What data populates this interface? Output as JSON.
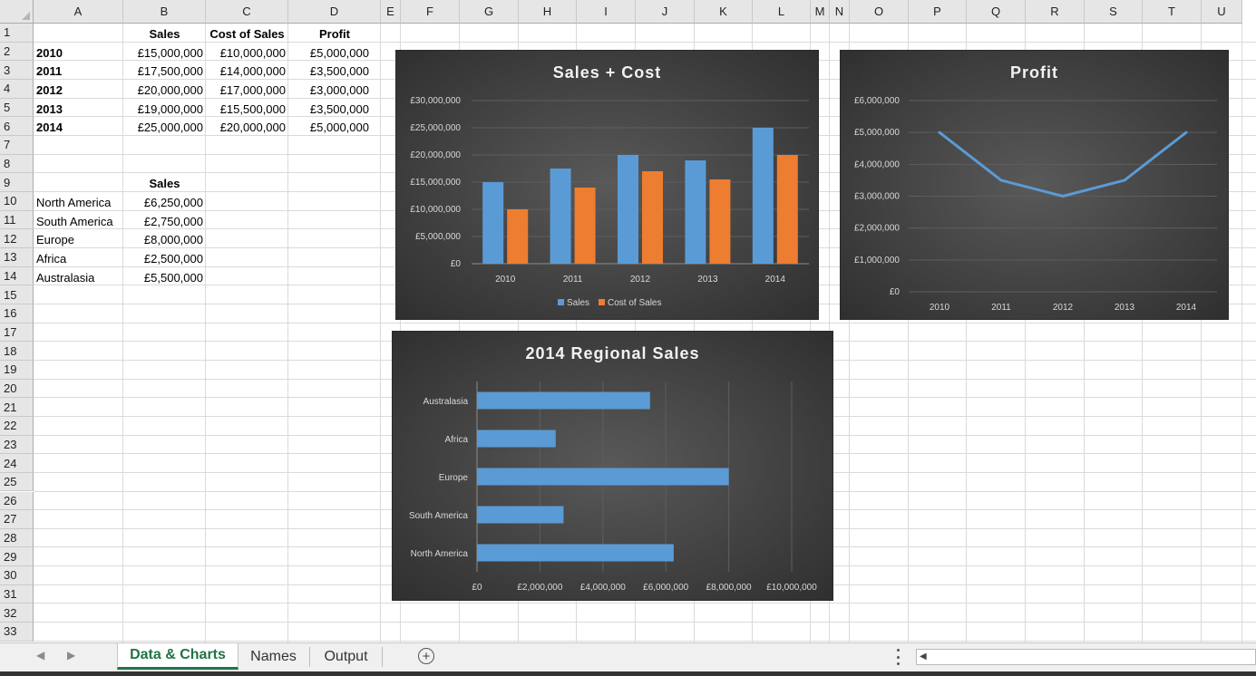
{
  "columns": [
    "A",
    "B",
    "C",
    "D",
    "E",
    "F",
    "G",
    "H",
    "I",
    "J",
    "K",
    "L",
    "M",
    "N",
    "O",
    "P",
    "Q",
    "R",
    "S",
    "T",
    "U"
  ],
  "rows": [
    "1",
    "2",
    "3",
    "4",
    "5",
    "6",
    "7",
    "8",
    "9",
    "10",
    "11",
    "12",
    "13",
    "14",
    "15",
    "16",
    "17",
    "18",
    "19",
    "20",
    "21",
    "22",
    "23",
    "24",
    "25",
    "26",
    "27",
    "28",
    "29",
    "30",
    "31",
    "32",
    "33"
  ],
  "table1": {
    "headers": [
      "Sales",
      "Cost of Sales",
      "Profit"
    ],
    "rows": [
      {
        "year": "2010",
        "sales": "£15,000,000",
        "cost": "£10,000,000",
        "profit": "£5,000,000"
      },
      {
        "year": "2011",
        "sales": "£17,500,000",
        "cost": "£14,000,000",
        "profit": "£3,500,000"
      },
      {
        "year": "2012",
        "sales": "£20,000,000",
        "cost": "£17,000,000",
        "profit": "£3,000,000"
      },
      {
        "year": "2013",
        "sales": "£19,000,000",
        "cost": "£15,500,000",
        "profit": "£3,500,000"
      },
      {
        "year": "2014",
        "sales": "£25,000,000",
        "cost": "£20,000,000",
        "profit": "£5,000,000"
      }
    ]
  },
  "table2": {
    "header": "Sales",
    "rows": [
      {
        "region": "North America",
        "sales": "£6,250,000"
      },
      {
        "region": "South America",
        "sales": "£2,750,000"
      },
      {
        "region": "Europe",
        "sales": "£8,000,000"
      },
      {
        "region": "Africa",
        "sales": "£2,500,000"
      },
      {
        "region": "Australasia",
        "sales": "£5,500,000"
      }
    ]
  },
  "colors": {
    "blue": "#5b9bd5",
    "orange": "#ed7d31",
    "excel_green": "#217346"
  },
  "chart_data": [
    {
      "type": "bar",
      "title": "Sales + Cost",
      "categories": [
        "2010",
        "2011",
        "2012",
        "2013",
        "2014"
      ],
      "series": [
        {
          "name": "Sales",
          "values": [
            15000000,
            17500000,
            20000000,
            19000000,
            25000000
          ]
        },
        {
          "name": "Cost of Sales",
          "values": [
            10000000,
            14000000,
            17000000,
            15500000,
            20000000
          ]
        }
      ],
      "yticks": [
        "£0",
        "£5,000,000",
        "£10,000,000",
        "£15,000,000",
        "£20,000,000",
        "£25,000,000",
        "£30,000,000"
      ],
      "ylim": [
        0,
        30000000
      ],
      "grid": true,
      "legend": "bottom"
    },
    {
      "type": "line",
      "title": "Profit",
      "categories": [
        "2010",
        "2011",
        "2012",
        "2013",
        "2014"
      ],
      "series": [
        {
          "values": [
            5000000,
            3500000,
            3000000,
            3500000,
            5000000
          ]
        }
      ],
      "yticks": [
        "£0",
        "£1,000,000",
        "£2,000,000",
        "£3,000,000",
        "£4,000,000",
        "£5,000,000",
        "£6,000,000"
      ],
      "ylim": [
        0,
        6000000
      ],
      "grid": true
    },
    {
      "type": "bar",
      "orientation": "horizontal",
      "title": "2014 Regional Sales",
      "categories": [
        "North America",
        "South America",
        "Europe",
        "Africa",
        "Australasia"
      ],
      "values": [
        6250000,
        2750000,
        8000000,
        2500000,
        5500000
      ],
      "xticks": [
        "£0",
        "£2,000,000",
        "£4,000,000",
        "£6,000,000",
        "£8,000,000",
        "£10,000,000"
      ],
      "xlim": [
        0,
        10000000
      ],
      "grid": true
    }
  ],
  "tabs": [
    "Data & Charts",
    "Names",
    "Output"
  ],
  "new_sheet_symbol": "+"
}
